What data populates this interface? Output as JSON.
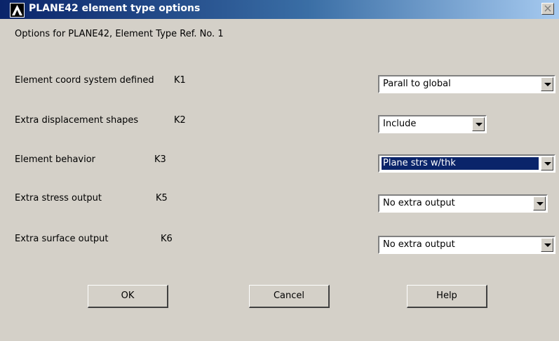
{
  "window": {
    "title": "PLANE42 element type options",
    "logo_icon": "ansys-logo-icon",
    "close_icon": "close-icon"
  },
  "heading": "Options for PLANE42, Element Type Ref. No. 1",
  "options": [
    {
      "label": "Element coord system defined",
      "key": "K1",
      "value": "Parall to global"
    },
    {
      "label": "Extra displacement shapes",
      "key": "K2",
      "value": "Include"
    },
    {
      "label": "Element behavior",
      "key": "K3",
      "value": "Plane strs w/thk"
    },
    {
      "label": "Extra stress output",
      "key": "K5",
      "value": "No extra output"
    },
    {
      "label": "Extra surface output",
      "key": "K6",
      "value": "No extra output"
    }
  ],
  "buttons": {
    "ok": "OK",
    "cancel": "Cancel",
    "help": "Help"
  },
  "colors": {
    "title_bar": "#0a246a",
    "dialog_bg": "#d4d0c8",
    "selection": "#0a246a"
  }
}
